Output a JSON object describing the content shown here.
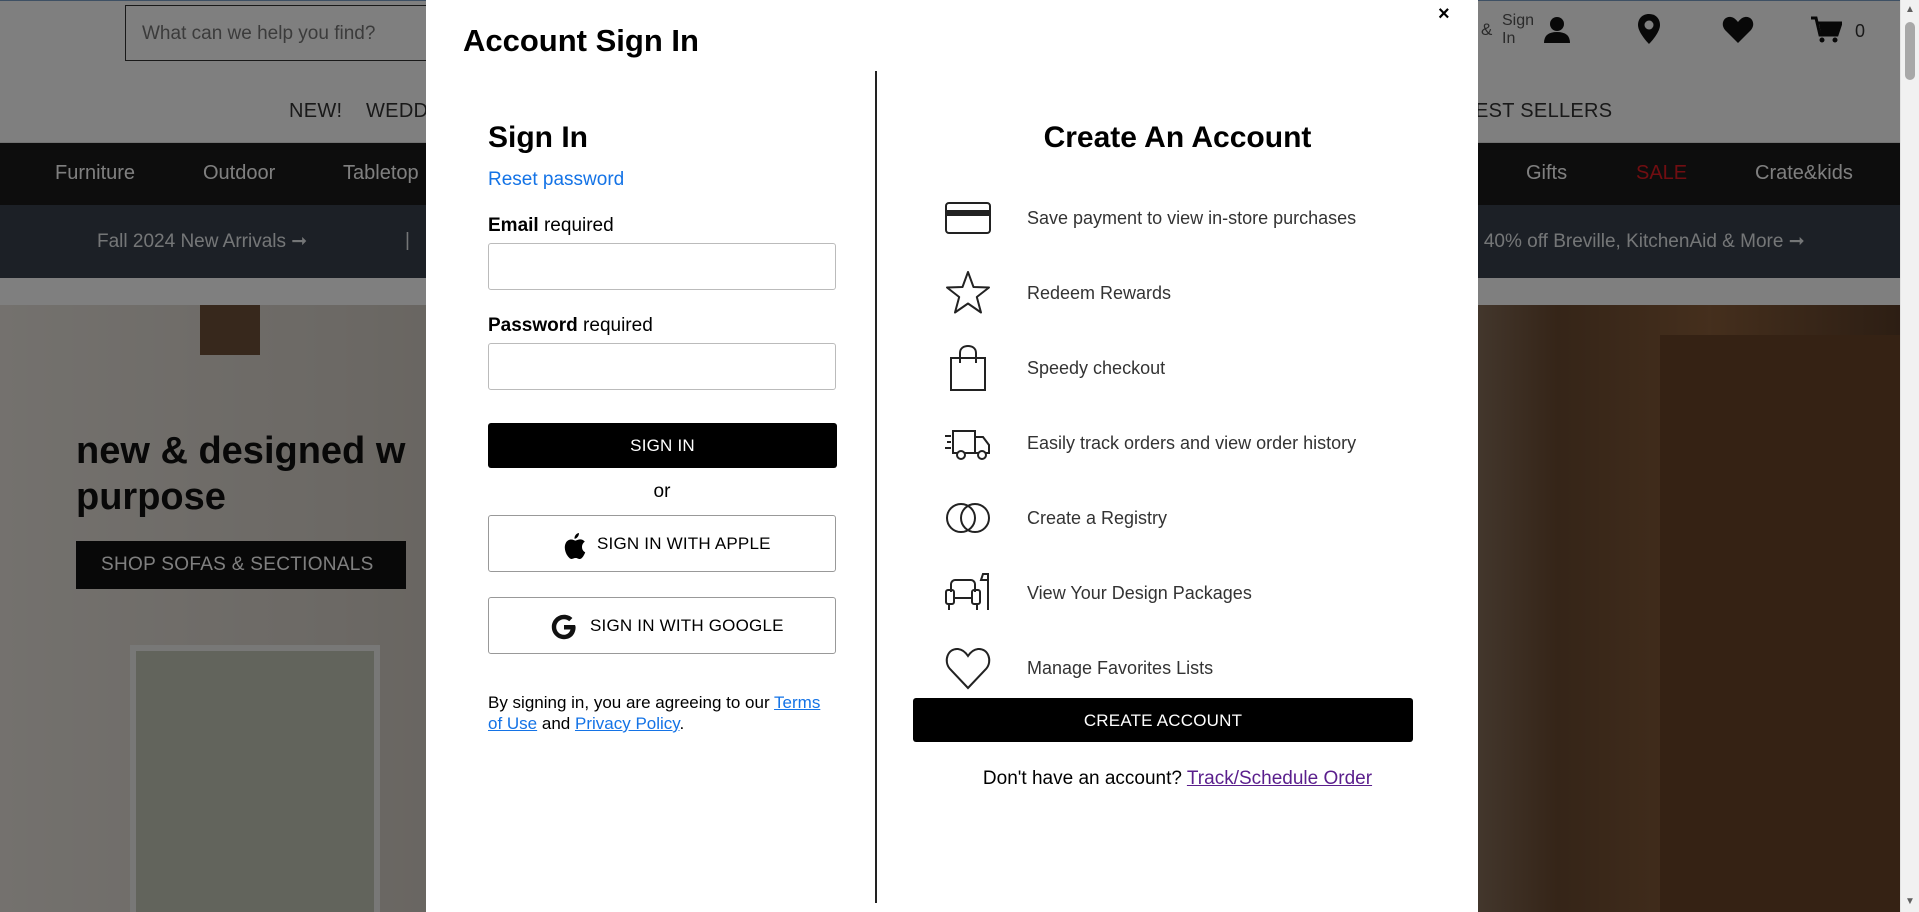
{
  "header": {
    "search_placeholder": "What can we help you find?",
    "account_amp": "&",
    "account_sign_in": "Sign In",
    "cart_count": "0"
  },
  "secondary_nav": {
    "items": [
      "NEW!",
      "WEDD",
      "EST SELLERS"
    ]
  },
  "main_nav": {
    "items": [
      "Furniture",
      "Outdoor",
      "Tabletop",
      "Gifts",
      "SALE",
      "Crate&kids"
    ],
    "sale_color": "#e21b22"
  },
  "promo_bar": {
    "left": "Fall 2024 New Arrivals ➞",
    "separator": "|",
    "right": "o 40% off Breville, KitchenAid & More ➞"
  },
  "hero": {
    "title": "new & designed w purpose",
    "cta": "SHOP SOFAS & SECTIONALS"
  },
  "modal": {
    "title": "Account Sign In",
    "close": "×",
    "sign_in": {
      "heading": "Sign In",
      "reset_password": "Reset password",
      "email_label": "Email",
      "password_label": "Password",
      "required": "required",
      "submit": "SIGN IN",
      "or": "or",
      "apple": "SIGN IN WITH APPLE",
      "google": "SIGN IN WITH GOOGLE",
      "terms_prefix": "By signing in, you are agreeing to our",
      "terms_link": "Terms of Use",
      "terms_and": "and",
      "privacy_link": "Privacy Policy",
      "terms_suffix": "."
    },
    "create_account": {
      "heading": "Create An Account",
      "benefits": [
        {
          "icon": "credit-card-icon",
          "text": "Save payment to view in-store purchases"
        },
        {
          "icon": "star-icon",
          "text": "Redeem Rewards"
        },
        {
          "icon": "shopping-bag-icon",
          "text": "Speedy checkout"
        },
        {
          "icon": "delivery-truck-icon",
          "text": "Easily track orders and view order history"
        },
        {
          "icon": "rings-icon",
          "text": "Create a Registry"
        },
        {
          "icon": "armchair-lamp-icon",
          "text": "View Your Design Packages"
        },
        {
          "icon": "heart-icon",
          "text": "Manage Favorites Lists"
        }
      ],
      "button": "CREATE ACCOUNT",
      "no_account": "Don't have an account?",
      "track_link": "Track/Schedule Order"
    }
  }
}
